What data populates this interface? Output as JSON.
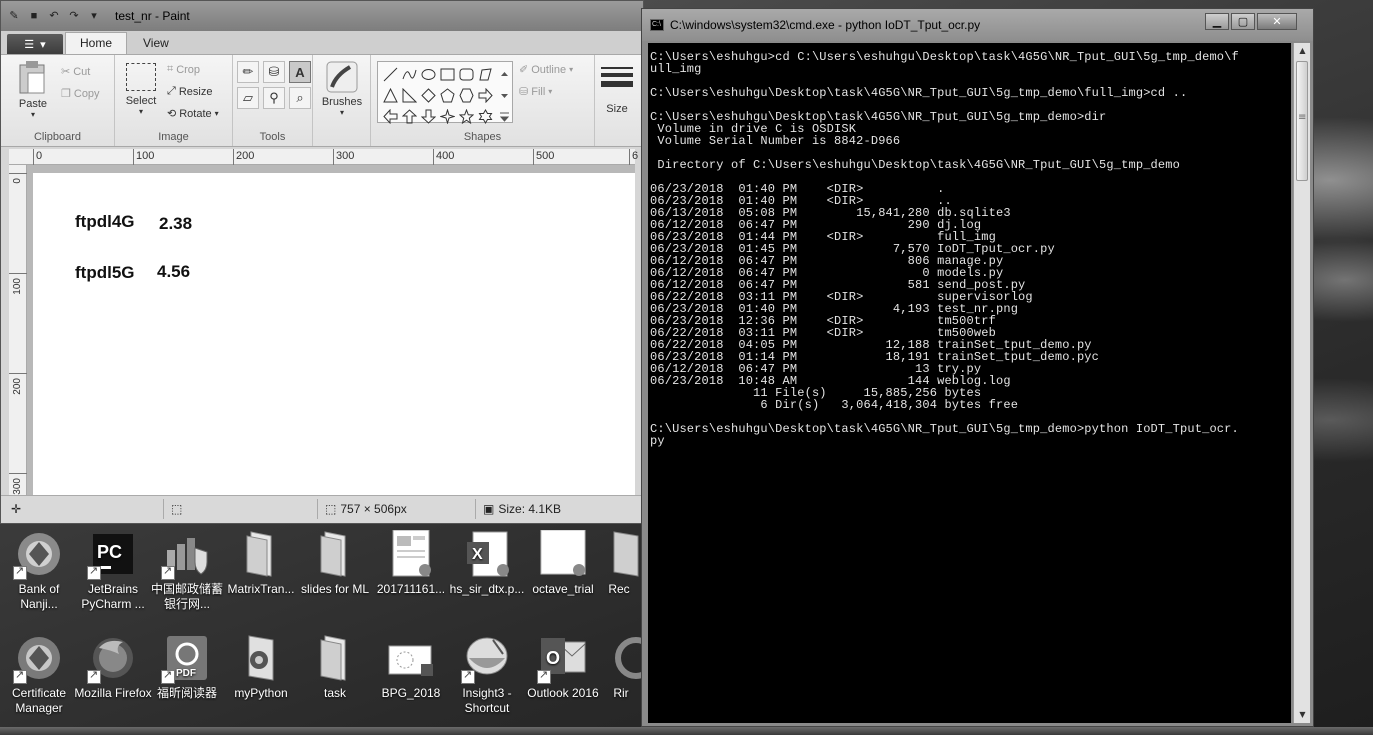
{
  "paint": {
    "title": "test_nr - Paint",
    "menu_button": "▾",
    "tabs": [
      "Home",
      "View"
    ],
    "clipboard": {
      "paste": "Paste",
      "cut": "Cut",
      "copy": "Copy",
      "label": "Clipboard"
    },
    "image": {
      "select": "Select",
      "crop": "Crop",
      "resize": "Resize",
      "rotate": "Rotate",
      "label": "Image"
    },
    "tools": {
      "label": "Tools"
    },
    "brushes": {
      "label": "Brushes"
    },
    "shapes": {
      "outline": "Outline",
      "fill": "Fill",
      "label": "Shapes"
    },
    "size": {
      "label": "Size"
    },
    "ruler_h": [
      "0",
      "100",
      "200",
      "300",
      "400",
      "500",
      "6"
    ],
    "ruler_v": [
      "0",
      "100",
      "200",
      "300"
    ],
    "canvas_text": [
      {
        "label": "ftpdl4G",
        "value": "2.38"
      },
      {
        "label": "ftpdl5G",
        "value": "4.56"
      }
    ],
    "status": {
      "dimensions": "757 × 506px",
      "size": "Size: 4.1KB"
    }
  },
  "cmd": {
    "title": "C:\\windows\\system32\\cmd.exe - python  IoDT_Tput_ocr.py",
    "lines": [
      "C:\\Users\\eshuhgu>cd C:\\Users\\eshuhgu\\Desktop\\task\\4G5G\\NR_Tput_GUI\\5g_tmp_demo\\f",
      "ull_img",
      "",
      "C:\\Users\\eshuhgu\\Desktop\\task\\4G5G\\NR_Tput_GUI\\5g_tmp_demo\\full_img>cd ..",
      "",
      "C:\\Users\\eshuhgu\\Desktop\\task\\4G5G\\NR_Tput_GUI\\5g_tmp_demo>dir",
      " Volume in drive C is OSDISK",
      " Volume Serial Number is 8842-D966",
      "",
      " Directory of C:\\Users\\eshuhgu\\Desktop\\task\\4G5G\\NR_Tput_GUI\\5g_tmp_demo",
      "",
      "06/23/2018  01:40 PM    <DIR>          .",
      "06/23/2018  01:40 PM    <DIR>          ..",
      "06/13/2018  05:08 PM        15,841,280 db.sqlite3",
      "06/12/2018  06:47 PM               290 dj.log",
      "06/23/2018  01:44 PM    <DIR>          full_img",
      "06/23/2018  01:45 PM             7,570 IoDT_Tput_ocr.py",
      "06/12/2018  06:47 PM               806 manage.py",
      "06/12/2018  06:47 PM                 0 models.py",
      "06/12/2018  06:47 PM               581 send_post.py",
      "06/22/2018  03:11 PM    <DIR>          supervisorlog",
      "06/23/2018  01:40 PM             4,193 test_nr.png",
      "06/23/2018  12:36 PM    <DIR>          tm500trf",
      "06/22/2018  03:11 PM    <DIR>          tm500web",
      "06/22/2018  04:05 PM            12,188 trainSet_tput_demo.py",
      "06/23/2018  01:14 PM            18,191 trainSet_tput_demo.pyc",
      "06/12/2018  06:47 PM                13 try.py",
      "06/23/2018  10:48 AM               144 weblog.log",
      "              11 File(s)     15,885,256 bytes",
      "               6 Dir(s)   3,064,418,304 bytes free",
      "",
      "C:\\Users\\eshuhgu\\Desktop\\task\\4G5G\\NR_Tput_GUI\\5g_tmp_demo>python IoDT_Tput_ocr.",
      "py"
    ]
  },
  "desktop_icons": [
    "Bank of Nanji...",
    "JetBrains PyCharm ...",
    "中国邮政储蓄银行网...",
    "MatrixTran...",
    "slides for ML",
    "201711161...",
    "hs_sir_dtx.p...",
    "octave_trial",
    "Rec",
    "Certificate Manager",
    "Mozilla Firefox",
    "福昕阅读器",
    "myPython",
    "task",
    "BPG_2018",
    "Insight3 - Shortcut",
    "Outlook 2016",
    "Rir"
  ],
  "window_controls": {
    "minimize": "▁",
    "maximize": "▢",
    "close": "✕"
  }
}
